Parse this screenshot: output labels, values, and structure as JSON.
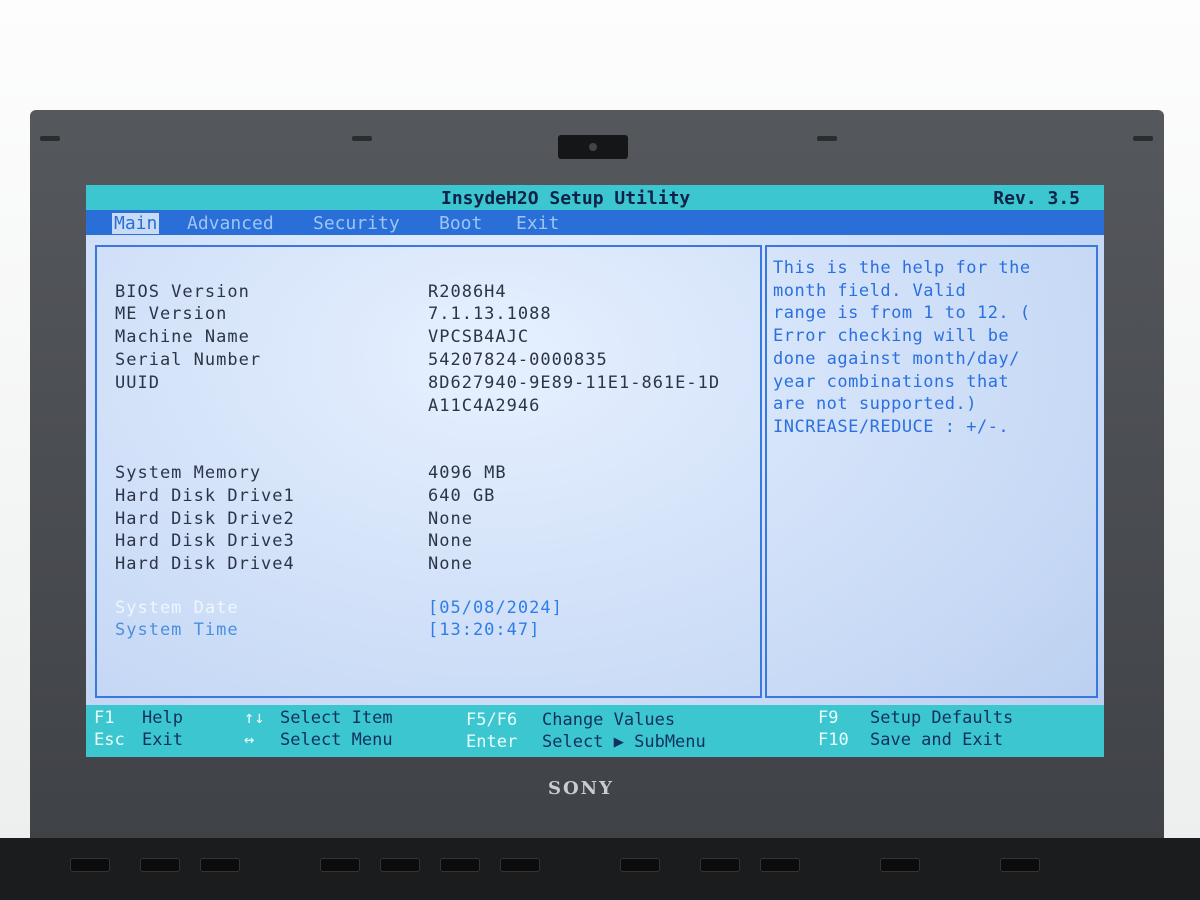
{
  "device": {
    "brand": "SONY"
  },
  "bios": {
    "title": "InsydeH2O Setup Utility",
    "revision": "Rev. 3.5",
    "menu": [
      "Main",
      "Advanced",
      "Security",
      "Boot",
      "Exit"
    ],
    "active_menu": "Main",
    "info": [
      {
        "label": "BIOS Version",
        "value": "R2086H4"
      },
      {
        "label": "ME Version",
        "value": "7.1.13.1088"
      },
      {
        "label": "Machine Name",
        "value": "VPCSB4AJC"
      },
      {
        "label": "Serial Number",
        "value": "54207824-0000835"
      },
      {
        "label": "UUID",
        "value": "8D627940-9E89-11E1-861E-1D",
        "value2": "A11C4A2946"
      },
      {
        "label": "System Memory",
        "value": "4096 MB"
      },
      {
        "label": "Hard Disk Drive1",
        "value": "640 GB"
      },
      {
        "label": "Hard Disk Drive2",
        "value": "None"
      },
      {
        "label": "Hard Disk Drive3",
        "value": "None"
      },
      {
        "label": "Hard Disk Drive4",
        "value": "None"
      },
      {
        "label": "System Date",
        "value": "[05/08/2024]"
      },
      {
        "label": "System Time",
        "value": "[13:20:47]"
      }
    ],
    "help": [
      "This is the help for the",
      "month field. Valid",
      "range is from 1 to 12. (",
      "Error checking will be",
      "done against month/day/",
      "year combinations that",
      "are not supported.)",
      "INCREASE/REDUCE : +/-."
    ],
    "footer": [
      {
        "key": "F1",
        "desc": "Help"
      },
      {
        "key": "Esc",
        "desc": "Exit"
      },
      {
        "key": "↑↓",
        "desc": "Select Item"
      },
      {
        "key": "↔",
        "desc": "Select Menu"
      },
      {
        "key": "F5/F6",
        "desc": "Change Values"
      },
      {
        "key": "Enter",
        "desc": "Select ▶ SubMenu"
      },
      {
        "key": "F9",
        "desc": "Setup Defaults"
      },
      {
        "key": "F10",
        "desc": "Save and Exit"
      }
    ]
  }
}
